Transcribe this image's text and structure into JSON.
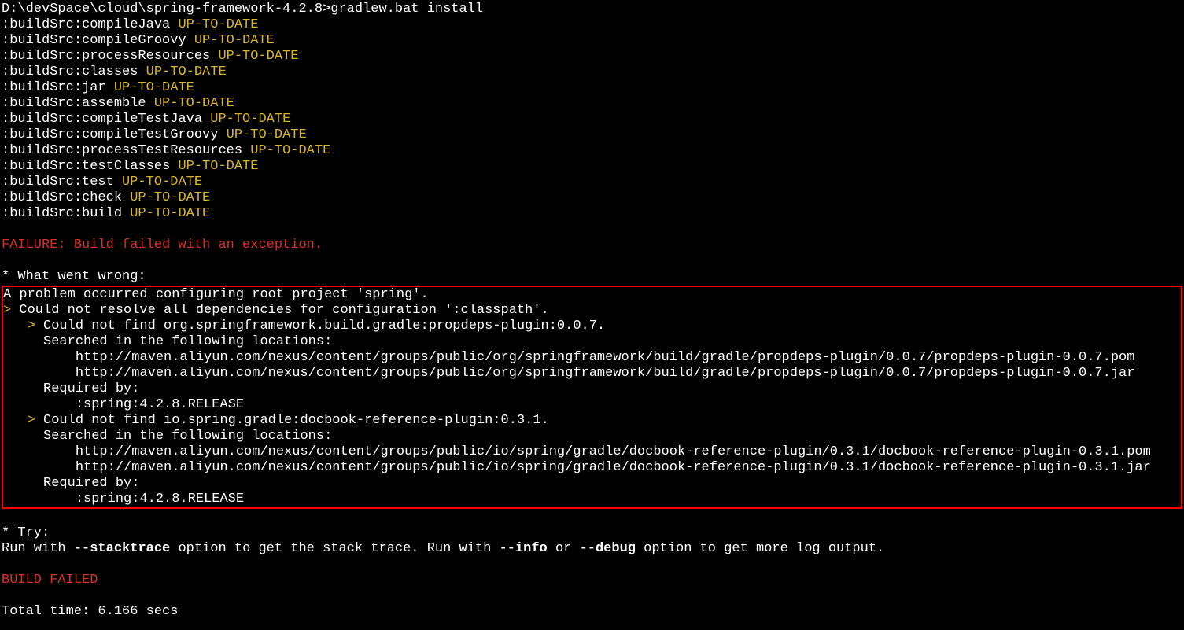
{
  "prompt": "D:\\devSpace\\cloud\\spring-framework-4.2.8>gradlew.bat install",
  "tasks": [
    {
      "name": ":buildSrc:compileJava ",
      "status": "UP-TO-DATE"
    },
    {
      "name": ":buildSrc:compileGroovy ",
      "status": "UP-TO-DATE"
    },
    {
      "name": ":buildSrc:processResources ",
      "status": "UP-TO-DATE"
    },
    {
      "name": ":buildSrc:classes ",
      "status": "UP-TO-DATE"
    },
    {
      "name": ":buildSrc:jar ",
      "status": "UP-TO-DATE"
    },
    {
      "name": ":buildSrc:assemble ",
      "status": "UP-TO-DATE"
    },
    {
      "name": ":buildSrc:compileTestJava ",
      "status": "UP-TO-DATE"
    },
    {
      "name": ":buildSrc:compileTestGroovy ",
      "status": "UP-TO-DATE"
    },
    {
      "name": ":buildSrc:processTestResources ",
      "status": "UP-TO-DATE"
    },
    {
      "name": ":buildSrc:testClasses ",
      "status": "UP-TO-DATE"
    },
    {
      "name": ":buildSrc:test ",
      "status": "UP-TO-DATE"
    },
    {
      "name": ":buildSrc:check ",
      "status": "UP-TO-DATE"
    },
    {
      "name": ":buildSrc:build ",
      "status": "UP-TO-DATE"
    }
  ],
  "failure": "FAILURE: Build failed with an exception.",
  "whatWentWrong": "* What went wrong:",
  "errorBox": {
    "line1": "A problem occurred configuring root project 'spring'.",
    "line2_pre": "> ",
    "line2": "Could not resolve all dependencies for configuration ':classpath'.",
    "line3_pre": "   > ",
    "line3": "Could not find org.springframework.build.gradle:propdeps-plugin:0.0.7.",
    "line4": "     Searched in the following locations:",
    "line5": "         http://maven.aliyun.com/nexus/content/groups/public/org/springframework/build/gradle/propdeps-plugin/0.0.7/propdeps-plugin-0.0.7.pom",
    "line6": "         http://maven.aliyun.com/nexus/content/groups/public/org/springframework/build/gradle/propdeps-plugin/0.0.7/propdeps-plugin-0.0.7.jar",
    "line7": "     Required by:",
    "line8": "         :spring:4.2.8.RELEASE",
    "line9_pre": "   > ",
    "line9": "Could not find io.spring.gradle:docbook-reference-plugin:0.3.1.",
    "line10": "     Searched in the following locations:",
    "line11": "         http://maven.aliyun.com/nexus/content/groups/public/io/spring/gradle/docbook-reference-plugin/0.3.1/docbook-reference-plugin-0.3.1.pom",
    "line12": "         http://maven.aliyun.com/nexus/content/groups/public/io/spring/gradle/docbook-reference-plugin/0.3.1/docbook-reference-plugin-0.3.1.jar",
    "line13": "     Required by:",
    "line14": "         :spring:4.2.8.RELEASE"
  },
  "try": "* Try:",
  "runWith1": "Run with ",
  "stacktrace": "--stacktrace",
  "runWith2": " option to get the stack trace. Run with ",
  "info": "--info",
  "runWith3": " or ",
  "debug": "--debug",
  "runWith4": " option to get more log output.",
  "buildFailed": "BUILD FAILED",
  "totalTime": "Total time: 6.166 secs"
}
